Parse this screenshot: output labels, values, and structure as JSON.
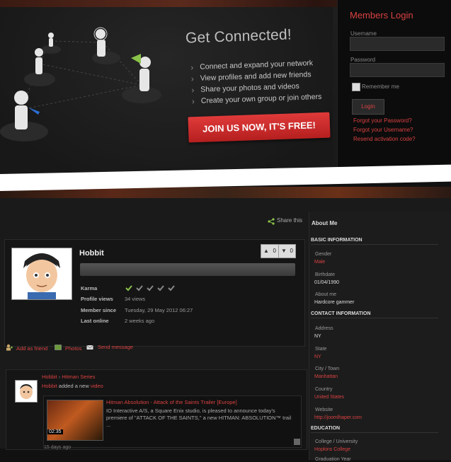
{
  "banner": {
    "title": "Get Connected!",
    "features": [
      "Connect and expand your network",
      "View profiles and add new friends",
      "Share your photos and videos",
      "Create your own group or join others"
    ],
    "join_label": "JOIN US NOW, IT'S FREE!"
  },
  "login": {
    "title": "Members Login",
    "username_label": "Username",
    "password_label": "Password",
    "remember_label": "Remember me",
    "button_label": "Login",
    "links": [
      "Forgot your Password?",
      "Forgot your Username?",
      "Resend activation code?"
    ]
  },
  "profile": {
    "share_label": "Share this",
    "name": "Hobbit",
    "likes": "0",
    "dislikes": "0",
    "stats": [
      {
        "label": "Karma",
        "value": ""
      },
      {
        "label": "Profile views",
        "value": "34 views"
      },
      {
        "label": "Member since",
        "value": "Tuesday, 29 May 2012 06:27"
      },
      {
        "label": "Last online",
        "value": "2 weeks ago"
      }
    ],
    "karma_level": 1,
    "karma_max": 5,
    "actions": [
      "Add as friend",
      "Photos",
      "Send message"
    ]
  },
  "activity": {
    "user": "Hobbit",
    "target": "Hitman Series",
    "action_text": "added a new",
    "object": "video",
    "video_title": "Hitman Absolution - Attack of the Saints Trailer [Europe]",
    "video_desc": "IO Interactive A/S, a Square Enix studio, is pleased to announce today's premiere of \"ATTACK OF THE SAINTS,\" a new  HITMAN: ABSOLUTION™ trail ...",
    "video_duration": "02:35",
    "time_ago": "15 days ago"
  },
  "about": {
    "title": "About Me",
    "basic_header": "BASIC INFORMATION",
    "gender_label": "Gender",
    "gender": "Male",
    "birthdate_label": "Birthdate",
    "birthdate": "01/04/1990",
    "aboutme_label": "About me",
    "aboutme": "Hardcore gammer",
    "contact_header": "CONTACT INFORMATION",
    "address_label": "Address",
    "address": "NY",
    "state_label": "State",
    "state": "NY",
    "city_label": "City / Town",
    "city": "Manhattan",
    "country_label": "Country",
    "country": "United States",
    "website_label": "Website",
    "website": "http://joomlhaper.com",
    "education_header": "EDUCATION",
    "college_label": "College / University",
    "college": "Hopkins College",
    "graduation_label": "Graduation Year"
  },
  "colors": {
    "accent": "#d94141",
    "join_button": "#c82a2a"
  }
}
